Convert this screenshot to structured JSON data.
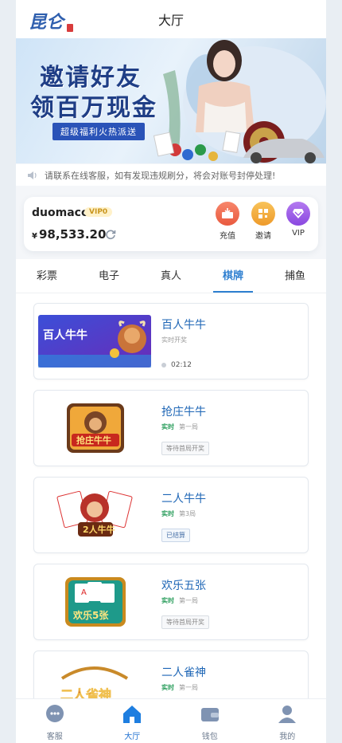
{
  "header": {
    "title": "大厅",
    "logo_text": "昆仑"
  },
  "banner": {
    "line1": "邀请好友",
    "line2": "领百万现金",
    "subtitle": "超级福利火热派送"
  },
  "notice": {
    "icon": "speaker-icon",
    "text": "请联系在线客服，如有发现违规刷分，将会对账号封停处理!"
  },
  "account": {
    "username": "duomacc",
    "vip_badge": "VIP0",
    "currency_symbol": "¥",
    "balance": "98,533.20",
    "actions": [
      {
        "label": "充值",
        "icon": "deposit-icon",
        "color": "#f26b4f"
      },
      {
        "label": "邀请",
        "icon": "invite-icon",
        "color": "#f2a63a"
      },
      {
        "label": "VIP",
        "icon": "vip-icon",
        "color": "#9b5ce6"
      }
    ]
  },
  "tabs": [
    "彩票",
    "电子",
    "真人",
    "棋牌",
    "捕鱼"
  ],
  "active_tab": "棋牌",
  "games": [
    {
      "name": "百人牛牛",
      "thumb_text": "百人牛牛",
      "line1": "实时开奖",
      "timer": "02:12"
    },
    {
      "name": "抢庄牛牛",
      "thumb_text": "抢庄牛牛",
      "tag": "实时",
      "round": "第一局",
      "status": "等待首局开奖"
    },
    {
      "name": "二人牛牛",
      "thumb_text": "2人牛牛",
      "tag": "实时",
      "round": "第3局",
      "status": "已结算"
    },
    {
      "name": "欢乐五张",
      "thumb_text": "欢乐5张",
      "tag": "实时",
      "round": "第一局",
      "status": "等待首局开奖"
    },
    {
      "name": "二人雀神",
      "thumb_text": "二人雀神",
      "tag": "实时",
      "round": "第一局"
    }
  ],
  "bottom_nav": [
    {
      "label": "客服",
      "icon": "support-icon"
    },
    {
      "label": "大厅",
      "icon": "home-icon"
    },
    {
      "label": "钱包",
      "icon": "wallet-icon"
    },
    {
      "label": "我的",
      "icon": "profile-icon"
    }
  ],
  "colors": {
    "accent": "#2e7fd0",
    "game_title": "#1e66b6",
    "realtime": "#2a9d5c"
  }
}
